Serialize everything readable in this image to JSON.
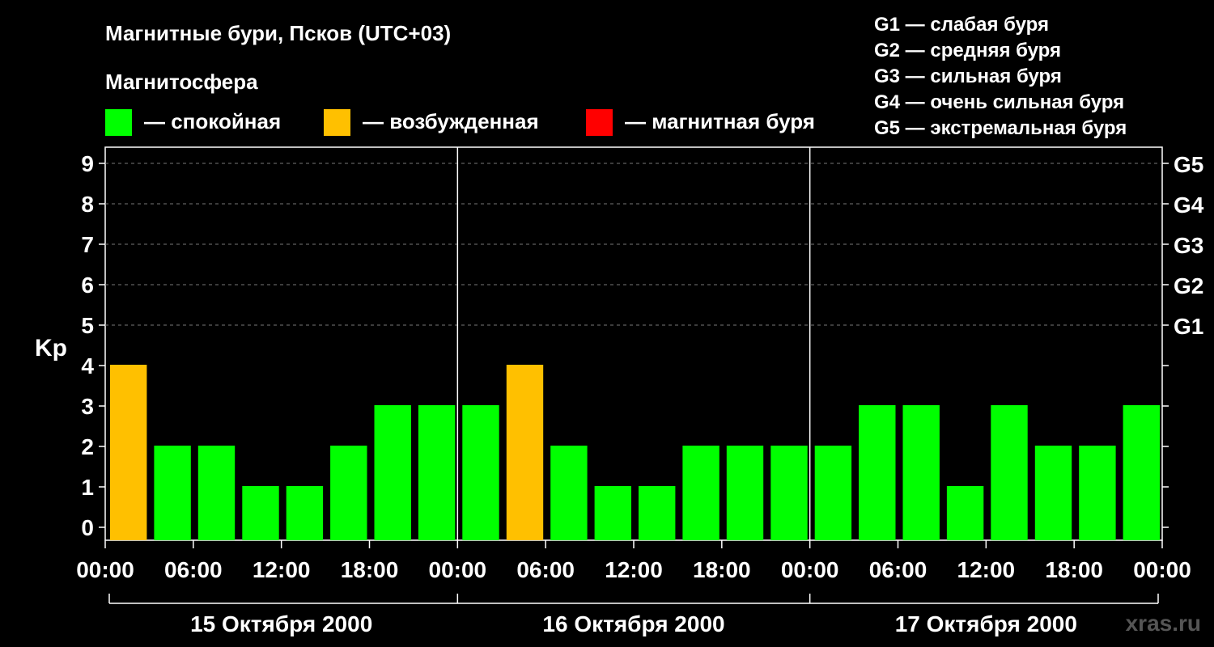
{
  "title": "Магнитные бури, Псков (UTC+03)",
  "legend": {
    "heading": "Магнитосфера",
    "items": [
      {
        "label": "— спокойная",
        "color": "#00ff00"
      },
      {
        "label": "— возбужденная",
        "color": "#ffc000"
      },
      {
        "label": "— магнитная буря",
        "color": "#ff0000"
      }
    ]
  },
  "g_legend": [
    "G1 — слабая буря",
    "G2 — средняя буря",
    "G3 — сильная буря",
    "G4 — очень сильная буря",
    "G5 — экстремальная буря"
  ],
  "watermark": "xras.ru",
  "chart_data": {
    "type": "bar",
    "ylabel": "Kp",
    "ylim": [
      0,
      9
    ],
    "yticks": [
      0,
      1,
      2,
      3,
      4,
      5,
      6,
      7,
      8,
      9
    ],
    "right_ticks": [
      {
        "value": 5,
        "label": "G1"
      },
      {
        "value": 6,
        "label": "G2"
      },
      {
        "value": 7,
        "label": "G3"
      },
      {
        "value": 8,
        "label": "G4"
      },
      {
        "value": 9,
        "label": "G5"
      }
    ],
    "grid": "dashed horizontal from Kp 5 to 9",
    "x_tick_labels": [
      "00:00",
      "06:00",
      "12:00",
      "18:00",
      "00:00",
      "06:00",
      "12:00",
      "18:00",
      "00:00",
      "06:00",
      "12:00",
      "18:00",
      "00:00"
    ],
    "days": [
      "15 Октября 2000",
      "16 Октября 2000",
      "17 Октября 2000"
    ],
    "interval_hours": 3,
    "values": [
      4,
      2,
      2,
      1,
      1,
      2,
      3,
      3,
      3,
      4,
      2,
      1,
      1,
      2,
      2,
      2,
      2,
      3,
      3,
      1,
      3,
      2,
      2,
      3
    ],
    "colors": {
      "quiet": "#00ff00",
      "active": "#ffc000",
      "storm": "#ff0000"
    }
  }
}
